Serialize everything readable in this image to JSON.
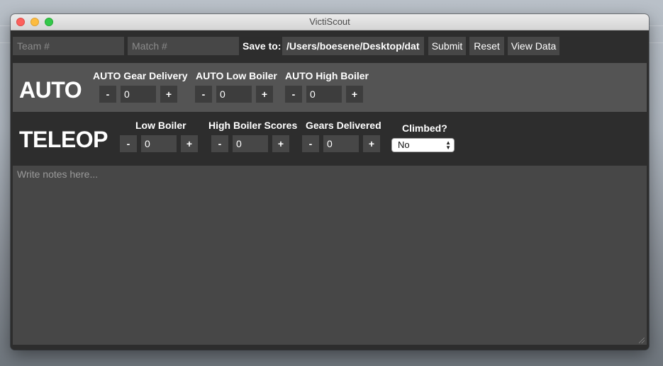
{
  "window": {
    "title": "VictiScout"
  },
  "topbar": {
    "team_placeholder": "Team #",
    "match_placeholder": "Match #",
    "save_to_label": "Save to:",
    "save_path": "/Users/boesene/Desktop/data.j",
    "submit_label": "Submit",
    "reset_label": "Reset",
    "view_data_label": "View Data"
  },
  "auto": {
    "title": "AUTO",
    "counters": [
      {
        "label": "AUTO Gear Delivery",
        "value": "0"
      },
      {
        "label": "AUTO Low Boiler",
        "value": "0"
      },
      {
        "label": "AUTO High Boiler",
        "value": "0"
      }
    ]
  },
  "teleop": {
    "title": "TELEOP",
    "counters": [
      {
        "label": "Low Boiler",
        "value": "0"
      },
      {
        "label": "High Boiler Scores",
        "value": "0"
      },
      {
        "label": "Gears Delivered",
        "value": "0"
      }
    ],
    "climbed": {
      "label": "Climbed?",
      "selected": "No"
    }
  },
  "stepper": {
    "minus": "-",
    "plus": "+"
  },
  "notes": {
    "placeholder": "Write notes here..."
  },
  "colors": {
    "panel_dark": "#2d2d2d",
    "panel_auto": "#545454",
    "control_bg": "#474747",
    "traffic_red": "#fc605c",
    "traffic_yellow": "#fdbc40",
    "traffic_green": "#34c84a"
  }
}
